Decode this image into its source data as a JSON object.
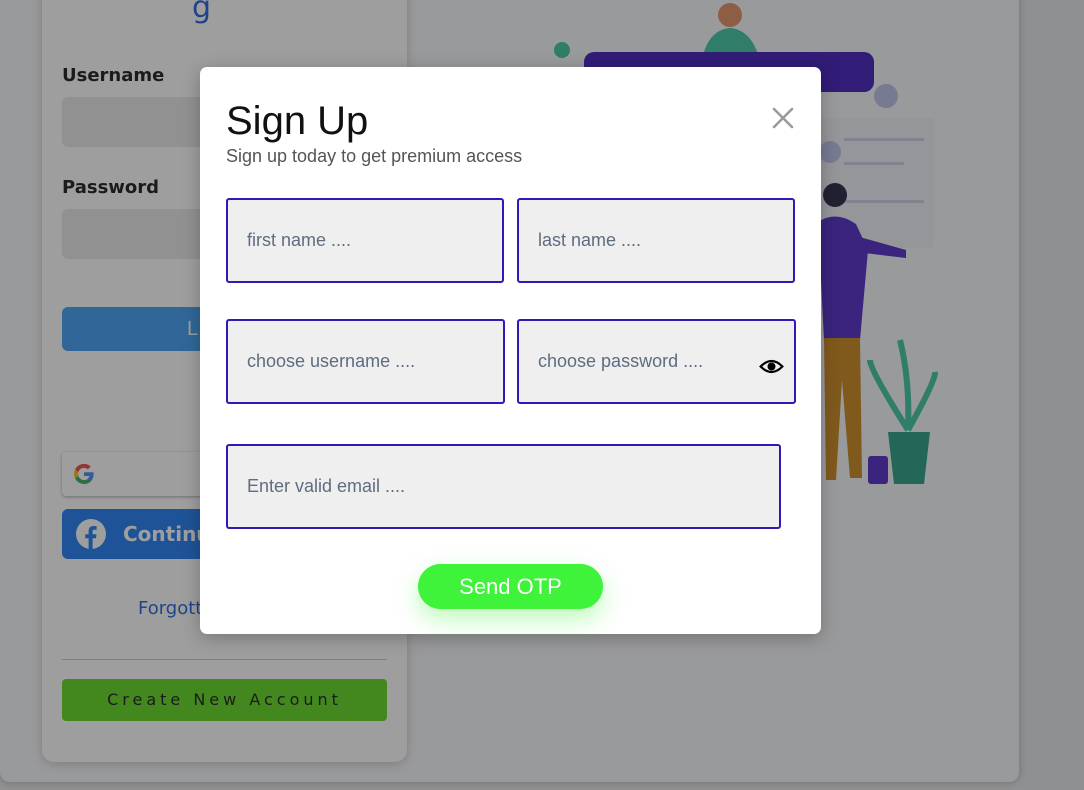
{
  "login": {
    "brand_partial": "g",
    "username_label": "Username",
    "password_label": "Password",
    "login_button_partial": "L",
    "facebook_button_partial": "Continu",
    "forgot_link_partial": "Forgott",
    "create_account_label": "Create New Account"
  },
  "modal": {
    "title": "Sign Up",
    "subtitle": "Sign up today to get premium access",
    "first_name_placeholder": "first name ....",
    "last_name_placeholder": "last name ....",
    "username_placeholder": "choose username ....",
    "password_placeholder": "choose password ....",
    "email_placeholder": "Enter valid email ....",
    "send_otp_label": "Send OTP"
  },
  "colors": {
    "input_border": "#2e1bb5",
    "send_otp": "#3ef339",
    "create_account": "#5ad818",
    "facebook": "#1877f2"
  },
  "icons": {
    "close": "close-icon",
    "eye": "eye-icon",
    "google": "google-icon",
    "facebook": "facebook-icon"
  }
}
